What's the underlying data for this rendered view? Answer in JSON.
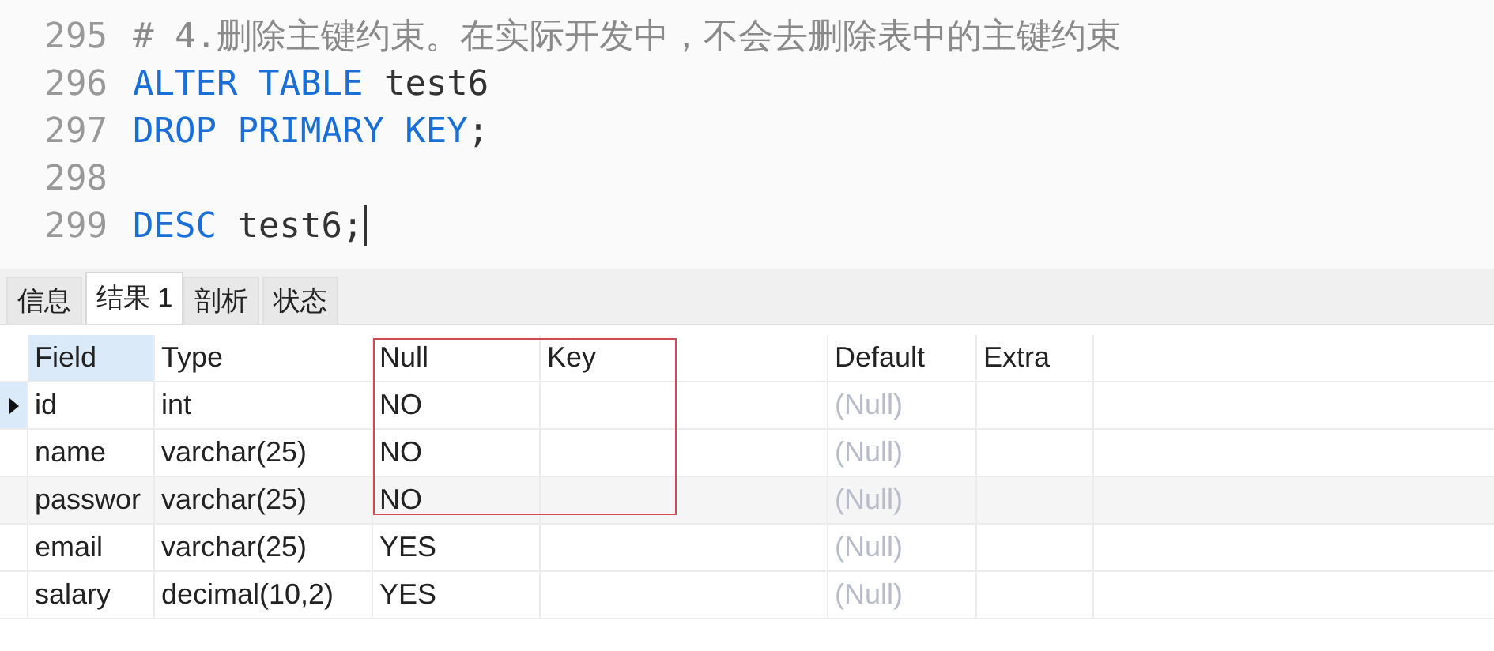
{
  "editor": {
    "lines": [
      {
        "number": "295",
        "tokens": [
          {
            "kind": "comment",
            "text": "# 4.删除主键约束。在实际开发中，不会去删除表中的主键约束"
          }
        ]
      },
      {
        "number": "296",
        "tokens": [
          {
            "kind": "keyword",
            "text": "ALTER TABLE"
          },
          {
            "kind": "plain",
            "text": " test6"
          }
        ]
      },
      {
        "number": "297",
        "tokens": [
          {
            "kind": "keyword",
            "text": "DROP PRIMARY KEY"
          },
          {
            "kind": "plain",
            "text": ";"
          }
        ]
      },
      {
        "number": "298"
      },
      {
        "number": "299",
        "tokens": [
          {
            "kind": "keyword",
            "text": "DESC"
          },
          {
            "kind": "plain",
            "text": " test6;"
          }
        ],
        "cursor": true
      }
    ]
  },
  "tabs": [
    {
      "label": "信息",
      "selected": false
    },
    {
      "label": "结果 1",
      "selected": true
    },
    {
      "label": "剖析",
      "selected": false
    },
    {
      "label": "状态",
      "selected": false
    }
  ],
  "table": {
    "columns": [
      "Field",
      "Type",
      "Null",
      "Key",
      "Default",
      "Extra"
    ],
    "rows": [
      {
        "selected": true,
        "cells": [
          "id",
          "int",
          "NO",
          "",
          "(Null)",
          ""
        ]
      },
      {
        "selected": false,
        "cells": [
          "name",
          "varchar(25)",
          "NO",
          "",
          "(Null)",
          ""
        ]
      },
      {
        "selected": false,
        "cells": [
          "passwor",
          "varchar(25)",
          "NO",
          "",
          "(Null)",
          ""
        ]
      },
      {
        "selected": false,
        "cells": [
          "email",
          "varchar(25)",
          "YES",
          "",
          "(Null)",
          ""
        ]
      },
      {
        "selected": false,
        "cells": [
          "salary",
          "decimal(10,2)",
          "YES",
          "",
          "(Null)",
          ""
        ]
      }
    ]
  }
}
